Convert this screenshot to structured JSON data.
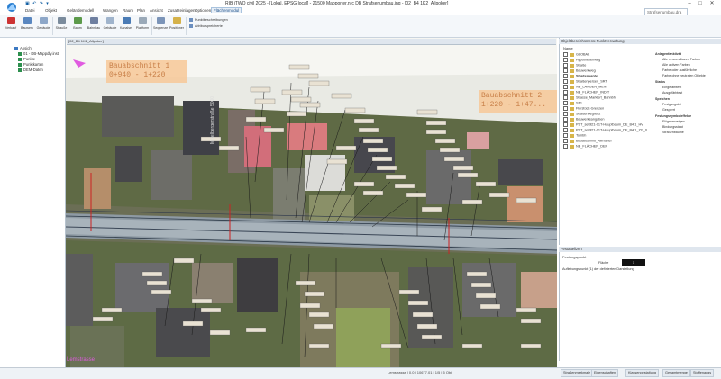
{
  "window": {
    "title": "RIB iTWO civil 2025 - [Lokal, EPSG local] - 21500 Mapporter.nrc DB Strafsenumbau.ing - [02_B4 1K2_Allpoker]",
    "search_placeholder": "Strafsenumbau.dra",
    "controls": [
      "–",
      "□",
      "✕"
    ]
  },
  "ribbon": {
    "tabs": [
      "Datei",
      "Objekt",
      "Geländemodell",
      "Wangen",
      "Raum",
      "Plan",
      "Ansicht",
      "Zusatzeinlagen",
      "Optionen",
      "Flächenmodul"
    ],
    "active_tab": "Flächenmodul",
    "buttons": [
      "Verkauf",
      "Bauwerk",
      "Gebäude",
      "Strauße",
      "Baum",
      "Bahnbau",
      "Gebäude",
      "Kanalset",
      "Plattform",
      "Straßen",
      "Bauplatz",
      "Stele",
      "Spezialisiert"
    ],
    "small_items": [
      "Punktbeschreibungen",
      "Attributspreicherte"
    ],
    "extra_buttons": [
      "Sequenzen",
      "Positionen"
    ]
  },
  "left_tree": {
    "items": [
      "Ansicht",
      "01 - DB-Mappdfy.inst",
      "Punkte",
      "Punktkarten",
      "DEM-Daten"
    ]
  },
  "map": {
    "tab_label": "[02_B4 1K2_Allpoker]",
    "section_labels": [
      "Bauabschnitt 1",
      "0+940 - 1+220",
      "Bauabschnitt 2",
      "1+220 - 1+47..."
    ],
    "street_label": "Mittelbergerstraße 5000",
    "coord_text": "Lemstrasse"
  },
  "right_panel": {
    "title": "Objektbereichsmenü   Punktverwaltung",
    "layer_header": "Name",
    "layers": [
      "GLOBAL",
      "Hypothekenweg",
      "Straße",
      "Bauwerkweg",
      "Straßenkante",
      "Straßenpersen_SRT",
      "NB_LANGEN_MENT",
      "NB_FLÄCHEN_INDIT",
      "Strasse_Markiert_Bahnbh",
      "ST1",
      "Flurstück-Grenzen",
      "Straßenbegrenz",
      "Bauwerksangaben",
      "PST_settli21-01T-Hauptbaum_DE_B4.1_HV",
      "PST_settli21-01T-Hauptbaum_DE_B4.1_ZG_0",
      "Tombh",
      "Bauabschnitt_Allmaster",
      "NB_FLÄCHEN_DEF"
    ],
    "filter_items": [
      "Anlagenfanktivät",
      "Alle verwendbaren Farben",
      "Alle aktiven Farben",
      "Farbe oder ausführliche",
      "Farbe ohne neutralen Objekte",
      "Status",
      "Eingefärbtest",
      "Ausgefärbtest",
      "Speichen",
      "Festgangsbit",
      "Gesperrt",
      "Festungssymboleffekte",
      "Flüge anzeigen",
      "Bindungsstaat",
      "Straßenbäume"
    ]
  },
  "attr_panel": {
    "title": "Festattelizen",
    "label1": "Festungspunkt",
    "label2": "Auflebungspunkt (1) der definierten Darstellung",
    "field1": "Fläche",
    "value1": "1"
  },
  "bottom": {
    "tabs": [
      "Straßenmerkmale",
      "Eigenschaften",
      "Klassengestaltung",
      "Gesamtmenge",
      "Stoffenaugs"
    ],
    "status": "Lemstrasse  |  0.0  |  10677.01   |   1/5   |   5 Obj"
  },
  "colors": {
    "accent": "#1a4f8a",
    "annotation_pink": "#e05be0",
    "label_orange": "#f7c898"
  }
}
